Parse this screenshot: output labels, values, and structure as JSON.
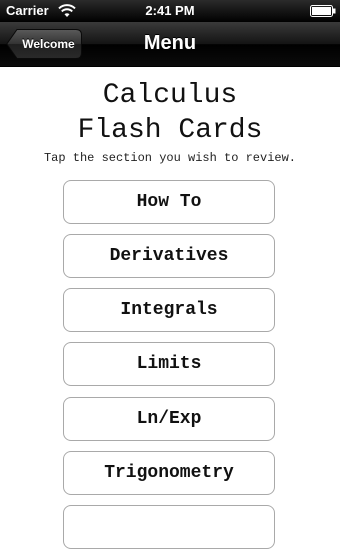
{
  "status_bar": {
    "carrier": "Carrier",
    "time": "2:41 PM"
  },
  "nav": {
    "back_label": "Welcome",
    "title": "Menu"
  },
  "content": {
    "title_line1": "Calculus",
    "title_line2": "Flash Cards",
    "subtitle": "Tap the section you wish to review."
  },
  "sections": [
    {
      "label": "How To"
    },
    {
      "label": "Derivatives"
    },
    {
      "label": "Integrals"
    },
    {
      "label": "Limits"
    },
    {
      "label": "Ln/Exp"
    },
    {
      "label": "Trigonometry"
    },
    {
      "label": ""
    }
  ],
  "icons": {
    "wifi": "wifi-icon",
    "battery": "battery-icon"
  }
}
